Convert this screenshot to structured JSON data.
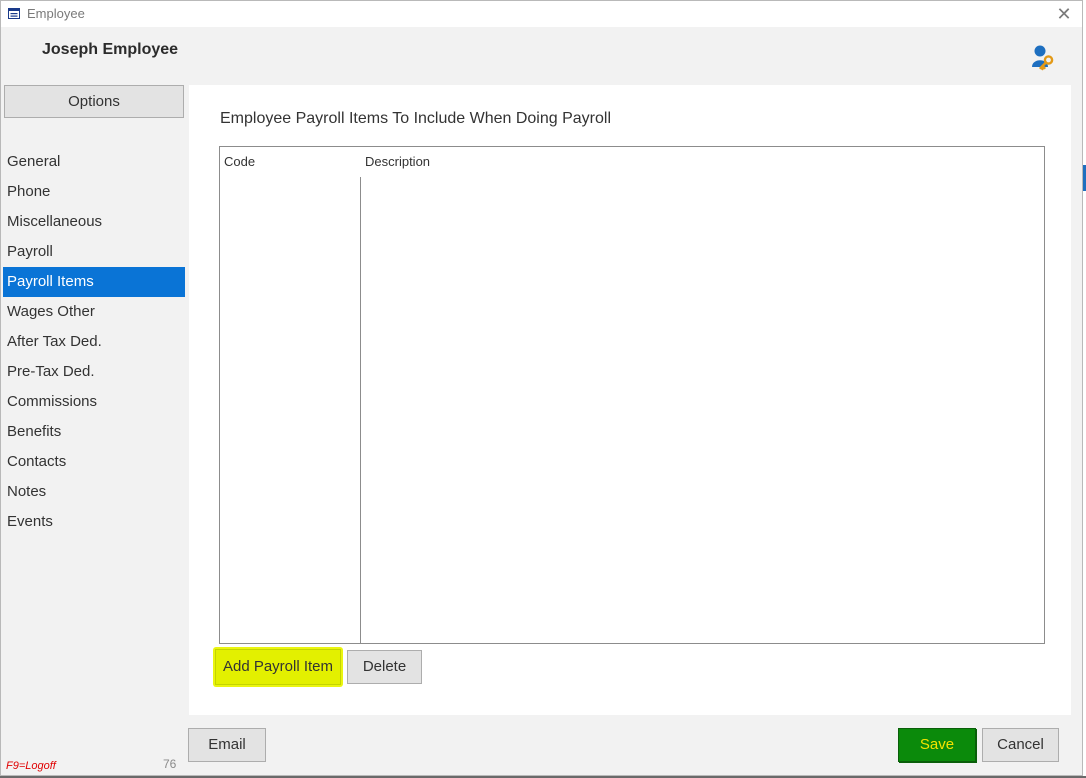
{
  "window": {
    "title": "Employee",
    "close_icon": "close-icon"
  },
  "header": {
    "employee_name": "Joseph Employee",
    "icon": "user-key-icon"
  },
  "sidebar": {
    "options_label": "Options",
    "items": [
      {
        "label": "General"
      },
      {
        "label": "Phone"
      },
      {
        "label": "Miscellaneous"
      },
      {
        "label": "Payroll"
      },
      {
        "label": "Payroll Items",
        "active": true
      },
      {
        "label": "Wages Other"
      },
      {
        "label": "After Tax Ded."
      },
      {
        "label": "Pre-Tax Ded."
      },
      {
        "label": "Commissions"
      },
      {
        "label": "Benefits"
      },
      {
        "label": "Contacts"
      },
      {
        "label": "Notes"
      },
      {
        "label": "Events"
      }
    ]
  },
  "main": {
    "title": "Employee Payroll Items To Include When Doing Payroll",
    "table": {
      "columns": [
        "Code",
        "Description"
      ],
      "rows": []
    },
    "add_button": "Add Payroll Item",
    "delete_button": "Delete"
  },
  "footer": {
    "email_button": "Email",
    "save_button": "Save",
    "cancel_button": "Cancel",
    "logoff_hint": "F9=Logoff",
    "count": "76"
  },
  "colors": {
    "accent": "#0a74d6",
    "save_bg": "#0b8a0b",
    "save_text": "#f4e300",
    "highlight": "#e3f000"
  }
}
